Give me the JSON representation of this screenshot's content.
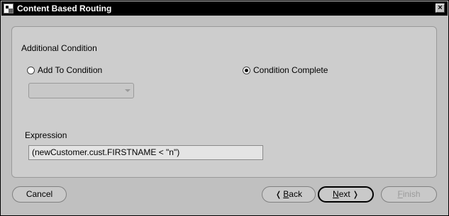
{
  "window": {
    "title": "Content Based Routing",
    "close_glyph": "×",
    "app_icon": "oracle-wizard-icon"
  },
  "panel": {
    "section_label": "Additional Condition",
    "radio_add": {
      "label": "Add To Condition",
      "checked": false
    },
    "radio_complete": {
      "label": "Condition Complete",
      "checked": true
    },
    "condition_select": {
      "value": "",
      "disabled": true
    },
    "expression": {
      "label": "Expression",
      "value": "(newCustomer.cust.FIRSTNAME < \"n\")"
    }
  },
  "buttons": {
    "cancel": "Cancel",
    "back": {
      "mnemonic": "B",
      "rest": "ack",
      "glyph": "❬"
    },
    "next": {
      "mnemonic": "N",
      "rest": "ext",
      "glyph": "❭"
    },
    "finish": {
      "mnemonic": "F",
      "rest": "inish",
      "disabled": true
    }
  }
}
